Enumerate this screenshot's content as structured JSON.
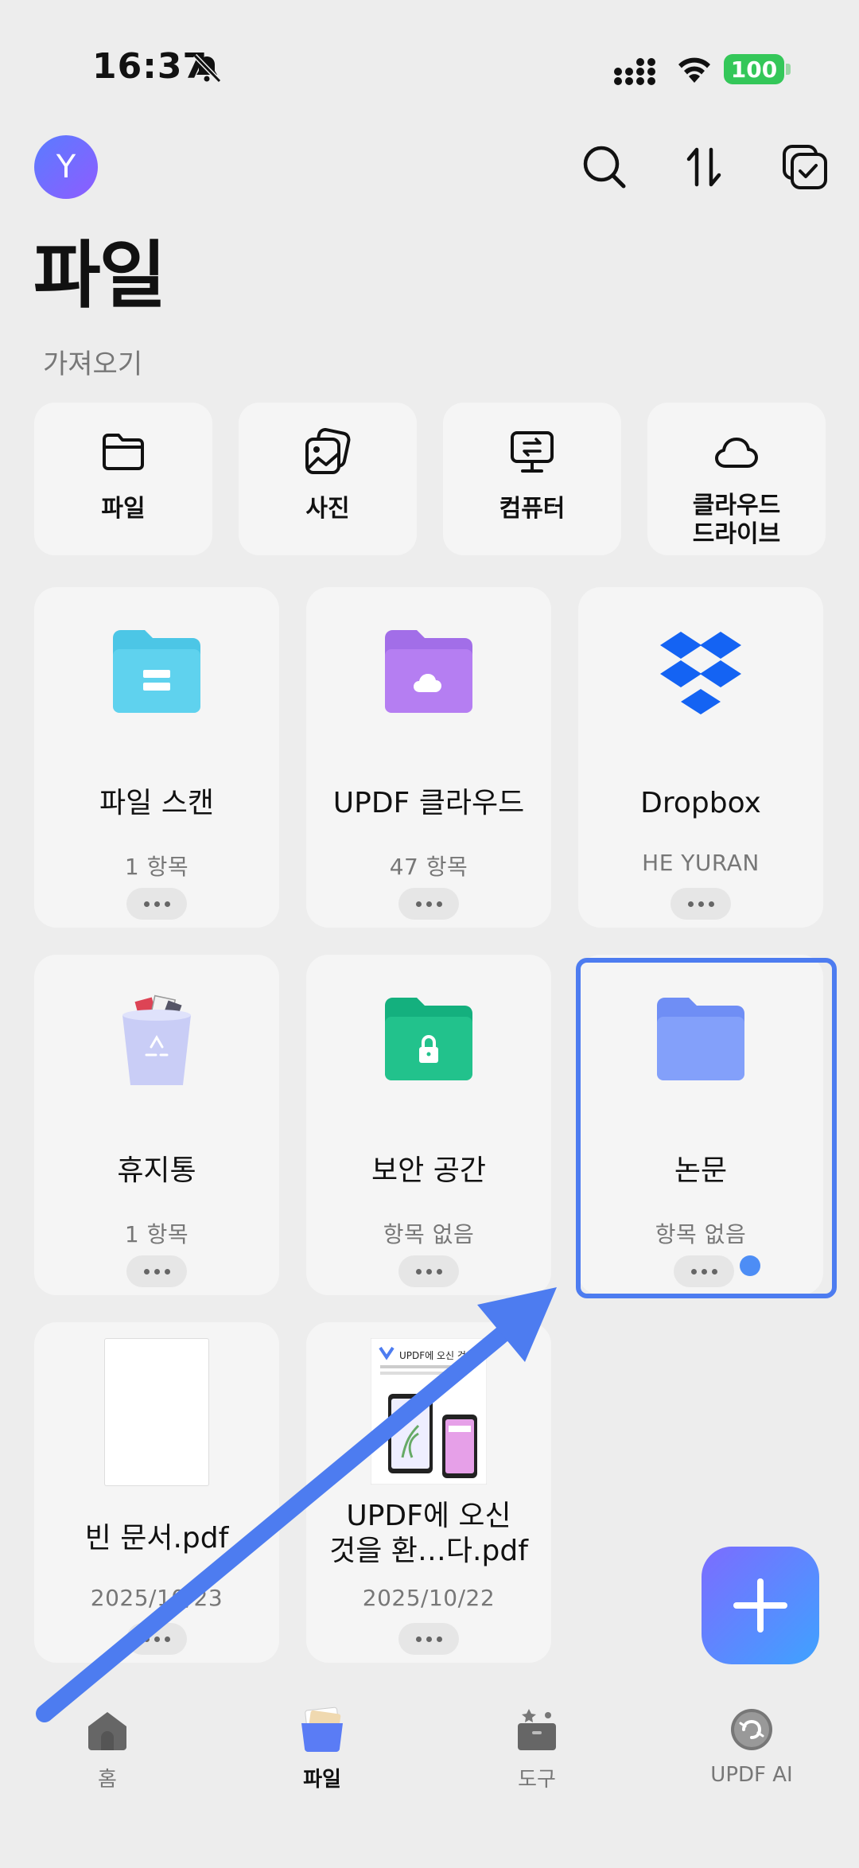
{
  "status": {
    "time": "16:37",
    "battery": "100"
  },
  "header": {
    "avatar_initial": "Y",
    "title": "파일"
  },
  "imports": {
    "label": "가져오기",
    "items": [
      {
        "label": "파일"
      },
      {
        "label": "사진"
      },
      {
        "label": "컴퓨터"
      },
      {
        "label": "클라우드\n드라이브"
      }
    ]
  },
  "cards": [
    {
      "title": "파일 스캔",
      "subtitle": "1 항목"
    },
    {
      "title": "UPDF 클라우드",
      "subtitle": "47 항목"
    },
    {
      "title": "Dropbox",
      "subtitle": "HE YURAN"
    },
    {
      "title": "휴지통",
      "subtitle": "1 항목"
    },
    {
      "title": "보안 공간",
      "subtitle": "항목 없음"
    },
    {
      "title": "논문",
      "subtitle": "항목 없음"
    },
    {
      "title": "빈 문서.pdf",
      "subtitle": "2025/10/23"
    },
    {
      "title": "UPDF에 오신\n것을 환…다.pdf",
      "subtitle": "2025/10/22"
    }
  ],
  "nav": {
    "home": "홈",
    "files": "파일",
    "tools": "도구",
    "ai": "UPDF AI"
  },
  "thumb_text": "UPDF에 오신 것",
  "colors": {
    "accent": "#4d7cf0",
    "battery": "#34c759"
  }
}
